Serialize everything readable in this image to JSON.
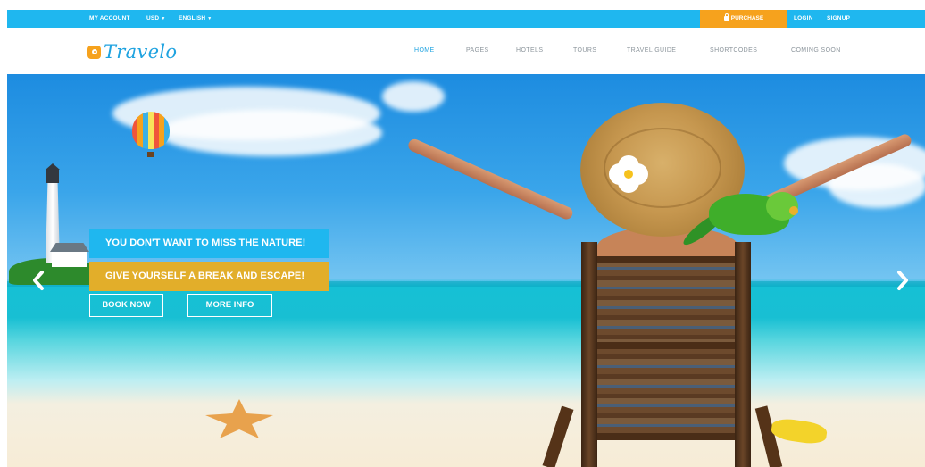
{
  "topbar": {
    "my_account": "MY ACCOUNT",
    "currency": "USD",
    "language": "ENGLISH",
    "purchase": "PURCHASE",
    "login": "LOGIN",
    "signup": "SIGNUP"
  },
  "brand": {
    "name": "Travelo"
  },
  "nav": {
    "items": [
      {
        "label": "HOME",
        "active": true
      },
      {
        "label": "PAGES"
      },
      {
        "label": "HOTELS"
      },
      {
        "label": "TOURS"
      },
      {
        "label": "TRAVEL GUIDE"
      },
      {
        "label": "SHORTCODES"
      },
      {
        "label": "COMING SOON"
      }
    ]
  },
  "hero": {
    "caption_1": "YOU DON'T WANT TO MISS THE NATURE!",
    "caption_2": "GIVE YOURSELF A BREAK AND ESCAPE!",
    "book_now": "BOOK NOW",
    "more_info": "MORE INFO"
  },
  "icons": {
    "prev": "chevron-left-icon",
    "next": "chevron-right-icon",
    "lock": "lock-icon",
    "caret": "caret-down-icon"
  },
  "colors": {
    "accent_blue": "#1fb7ef",
    "accent_orange": "#f6a21d",
    "caption_gold": "#e2ae2a"
  }
}
